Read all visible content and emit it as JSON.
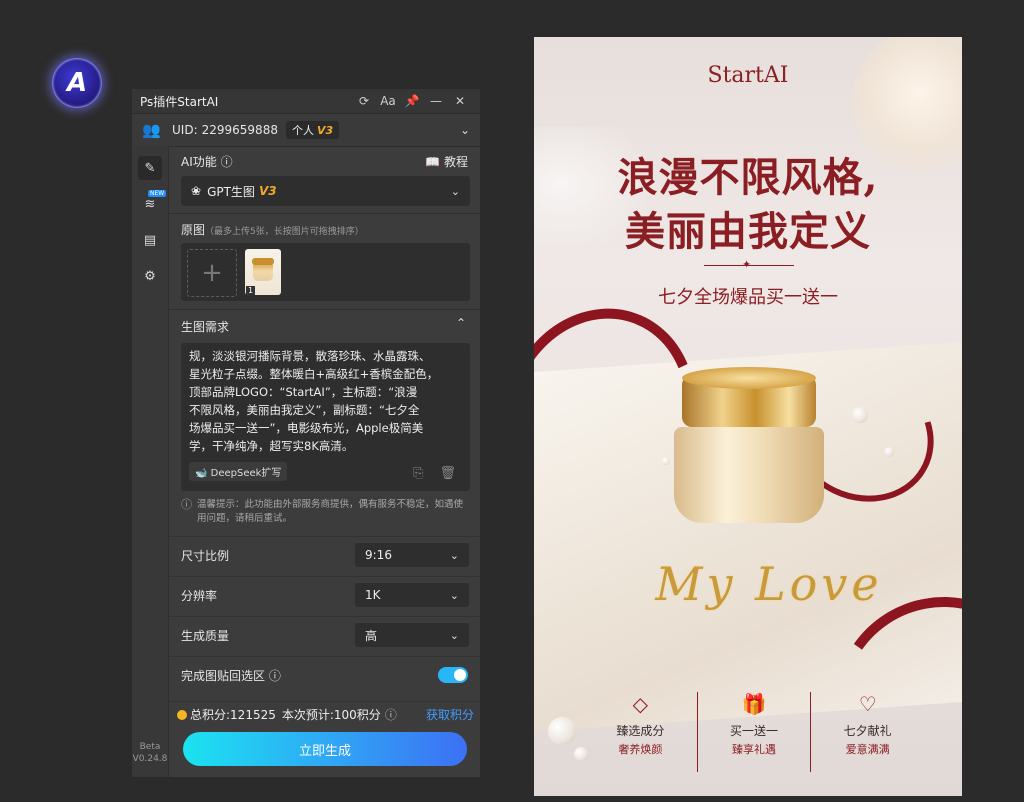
{
  "app_badge": {
    "letter": "A"
  },
  "panel": {
    "title": "Ps插件StartAI",
    "title_icons": [
      "refresh-icon",
      "text-size-icon",
      "pin-icon",
      "minimize-icon",
      "close-icon"
    ],
    "uid_label": "UID:",
    "uid_value": "2299659888",
    "plan_label": "个人",
    "plan_version": "V3",
    "sidebar": {
      "new_badge": "NEW",
      "version_line1": "Beta",
      "version_line2": "V0.24.8"
    },
    "ai_function": {
      "label": "AI功能",
      "tutorial": "教程",
      "selected": "GPT生图",
      "selected_version": "V3"
    },
    "source_image": {
      "label": "原图",
      "hint": "（最多上传5张，长按图片可拖拽排序）",
      "thumb_index": "1"
    },
    "prompt": {
      "label": "生图需求",
      "text": "规，淡淡银河播际背景，散落珍珠、水晶露珠、\n星光粒子点缀。整体暖白+高级红+香槟金配色，\n顶部品牌LOGO：“StartAI”，主标题：“浪漫\n不限风格，美丽由我定义”，副标题：“七夕全\n场爆品买一送一”，电影级布光，Apple极简美\n学，干净纯净，超写实8K高清。",
      "expand_button": "DeepSeek扩写"
    },
    "notice": "温馨提示：此功能由外部服务商提供，偶有服务不稳定，如遇使用问题，请稍后重试。",
    "settings": [
      {
        "label": "尺寸比例",
        "value": "9:16"
      },
      {
        "label": "分辨率",
        "value": "1K"
      },
      {
        "label": "生成质量",
        "value": "高"
      }
    ],
    "paste_back": {
      "label": "完成图贴回选区",
      "enabled": true
    },
    "points": {
      "total": "总积分:121525",
      "estimate": "本次预计:100积分",
      "get": "获取积分"
    },
    "generate_button": "立即生成"
  },
  "poster": {
    "brand": "StartAI",
    "headline1": "浪漫不限风格,",
    "headline2": "美丽由我定义",
    "subheadline": "七夕全场爆品买一送一",
    "script_text": "My Love",
    "features": [
      {
        "icon": "diamond-icon",
        "title": "臻选成分",
        "sub": "奢养焕颜"
      },
      {
        "icon": "gift-icon",
        "title": "买一送一",
        "sub": "臻享礼遇"
      },
      {
        "icon": "heart-icon",
        "title": "七夕献礼",
        "sub": "爱意满满"
      }
    ]
  },
  "colors": {
    "accent_red": "#8b1e23",
    "gold": "#f0a929",
    "button_gradient_start": "#1be3f0",
    "button_gradient_end": "#3c70f4",
    "link_blue": "#3f9dff"
  }
}
